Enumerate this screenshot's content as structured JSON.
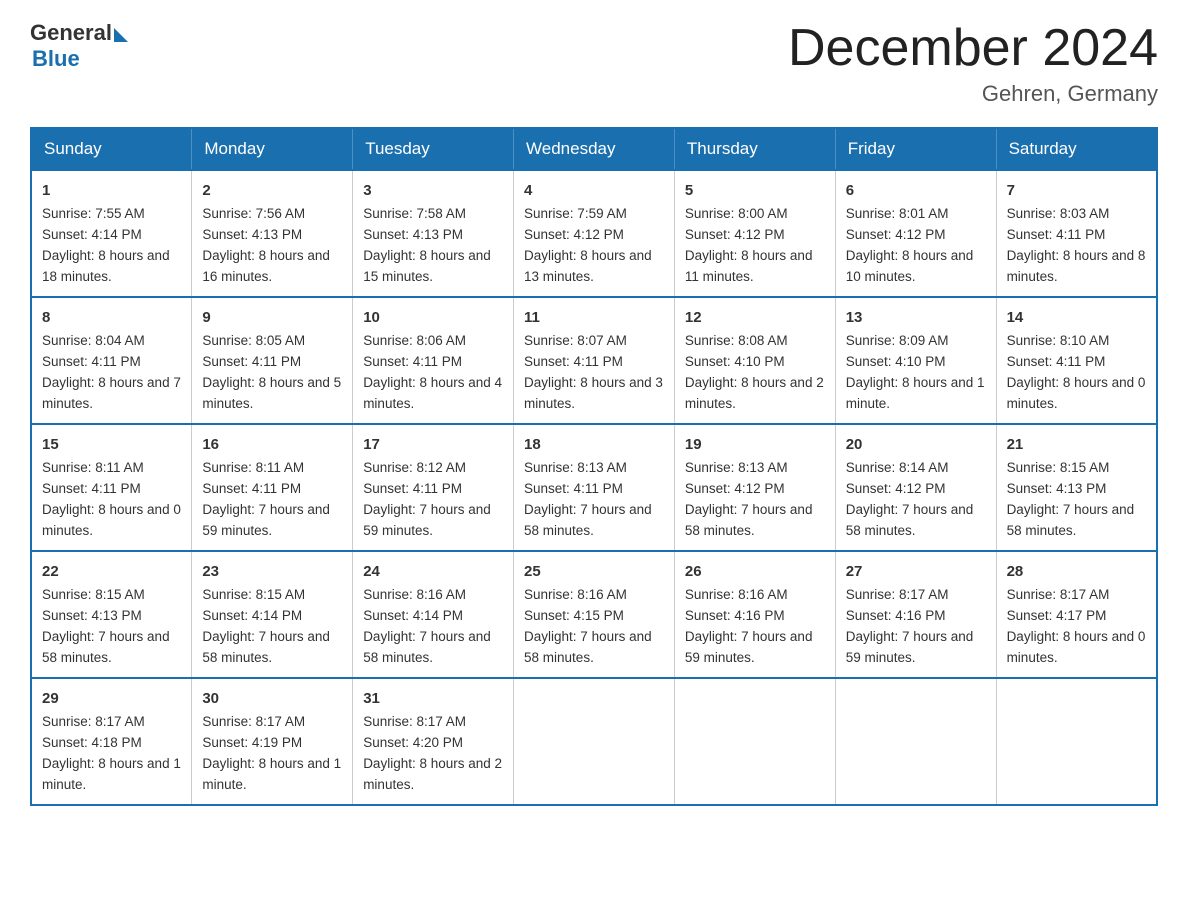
{
  "logo": {
    "general": "General",
    "blue": "Blue"
  },
  "title": "December 2024",
  "location": "Gehren, Germany",
  "weekdays": [
    "Sunday",
    "Monday",
    "Tuesday",
    "Wednesday",
    "Thursday",
    "Friday",
    "Saturday"
  ],
  "weeks": [
    [
      {
        "day": "1",
        "sunrise": "7:55 AM",
        "sunset": "4:14 PM",
        "daylight": "8 hours and 18 minutes."
      },
      {
        "day": "2",
        "sunrise": "7:56 AM",
        "sunset": "4:13 PM",
        "daylight": "8 hours and 16 minutes."
      },
      {
        "day": "3",
        "sunrise": "7:58 AM",
        "sunset": "4:13 PM",
        "daylight": "8 hours and 15 minutes."
      },
      {
        "day": "4",
        "sunrise": "7:59 AM",
        "sunset": "4:12 PM",
        "daylight": "8 hours and 13 minutes."
      },
      {
        "day": "5",
        "sunrise": "8:00 AM",
        "sunset": "4:12 PM",
        "daylight": "8 hours and 11 minutes."
      },
      {
        "day": "6",
        "sunrise": "8:01 AM",
        "sunset": "4:12 PM",
        "daylight": "8 hours and 10 minutes."
      },
      {
        "day": "7",
        "sunrise": "8:03 AM",
        "sunset": "4:11 PM",
        "daylight": "8 hours and 8 minutes."
      }
    ],
    [
      {
        "day": "8",
        "sunrise": "8:04 AM",
        "sunset": "4:11 PM",
        "daylight": "8 hours and 7 minutes."
      },
      {
        "day": "9",
        "sunrise": "8:05 AM",
        "sunset": "4:11 PM",
        "daylight": "8 hours and 5 minutes."
      },
      {
        "day": "10",
        "sunrise": "8:06 AM",
        "sunset": "4:11 PM",
        "daylight": "8 hours and 4 minutes."
      },
      {
        "day": "11",
        "sunrise": "8:07 AM",
        "sunset": "4:11 PM",
        "daylight": "8 hours and 3 minutes."
      },
      {
        "day": "12",
        "sunrise": "8:08 AM",
        "sunset": "4:10 PM",
        "daylight": "8 hours and 2 minutes."
      },
      {
        "day": "13",
        "sunrise": "8:09 AM",
        "sunset": "4:10 PM",
        "daylight": "8 hours and 1 minute."
      },
      {
        "day": "14",
        "sunrise": "8:10 AM",
        "sunset": "4:11 PM",
        "daylight": "8 hours and 0 minutes."
      }
    ],
    [
      {
        "day": "15",
        "sunrise": "8:11 AM",
        "sunset": "4:11 PM",
        "daylight": "8 hours and 0 minutes."
      },
      {
        "day": "16",
        "sunrise": "8:11 AM",
        "sunset": "4:11 PM",
        "daylight": "7 hours and 59 minutes."
      },
      {
        "day": "17",
        "sunrise": "8:12 AM",
        "sunset": "4:11 PM",
        "daylight": "7 hours and 59 minutes."
      },
      {
        "day": "18",
        "sunrise": "8:13 AM",
        "sunset": "4:11 PM",
        "daylight": "7 hours and 58 minutes."
      },
      {
        "day": "19",
        "sunrise": "8:13 AM",
        "sunset": "4:12 PM",
        "daylight": "7 hours and 58 minutes."
      },
      {
        "day": "20",
        "sunrise": "8:14 AM",
        "sunset": "4:12 PM",
        "daylight": "7 hours and 58 minutes."
      },
      {
        "day": "21",
        "sunrise": "8:15 AM",
        "sunset": "4:13 PM",
        "daylight": "7 hours and 58 minutes."
      }
    ],
    [
      {
        "day": "22",
        "sunrise": "8:15 AM",
        "sunset": "4:13 PM",
        "daylight": "7 hours and 58 minutes."
      },
      {
        "day": "23",
        "sunrise": "8:15 AM",
        "sunset": "4:14 PM",
        "daylight": "7 hours and 58 minutes."
      },
      {
        "day": "24",
        "sunrise": "8:16 AM",
        "sunset": "4:14 PM",
        "daylight": "7 hours and 58 minutes."
      },
      {
        "day": "25",
        "sunrise": "8:16 AM",
        "sunset": "4:15 PM",
        "daylight": "7 hours and 58 minutes."
      },
      {
        "day": "26",
        "sunrise": "8:16 AM",
        "sunset": "4:16 PM",
        "daylight": "7 hours and 59 minutes."
      },
      {
        "day": "27",
        "sunrise": "8:17 AM",
        "sunset": "4:16 PM",
        "daylight": "7 hours and 59 minutes."
      },
      {
        "day": "28",
        "sunrise": "8:17 AM",
        "sunset": "4:17 PM",
        "daylight": "8 hours and 0 minutes."
      }
    ],
    [
      {
        "day": "29",
        "sunrise": "8:17 AM",
        "sunset": "4:18 PM",
        "daylight": "8 hours and 1 minute."
      },
      {
        "day": "30",
        "sunrise": "8:17 AM",
        "sunset": "4:19 PM",
        "daylight": "8 hours and 1 minute."
      },
      {
        "day": "31",
        "sunrise": "8:17 AM",
        "sunset": "4:20 PM",
        "daylight": "8 hours and 2 minutes."
      },
      null,
      null,
      null,
      null
    ]
  ],
  "labels": {
    "sunrise": "Sunrise:",
    "sunset": "Sunset:",
    "daylight": "Daylight:"
  }
}
